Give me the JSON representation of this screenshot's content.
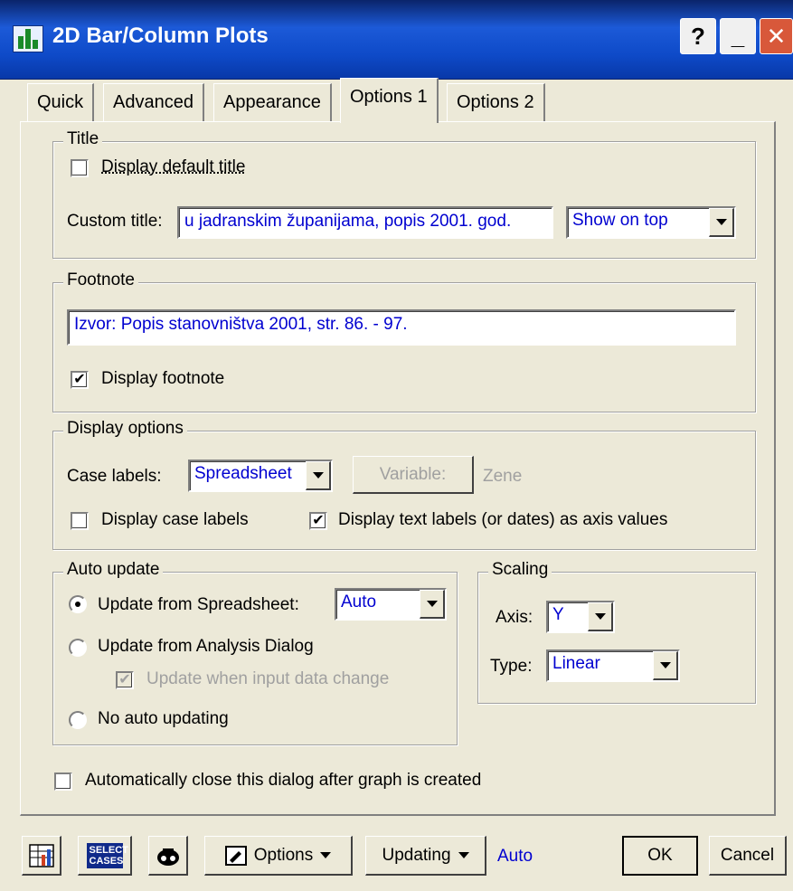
{
  "window": {
    "title": "2D Bar/Column Plots"
  },
  "title_buttons": {
    "help": "?",
    "minimize": "_",
    "close": "✕"
  },
  "tabs": [
    "Quick",
    "Advanced",
    "Appearance",
    "Options 1",
    "Options 2"
  ],
  "active_tab": "Options 1",
  "title_group": {
    "legend": "Title",
    "display_default_title": {
      "label": "Display default title",
      "checked": false
    },
    "custom_title_label": "Custom title:",
    "custom_title_value": "u jadranskim županijama, popis 2001. god.",
    "position": "Show on top"
  },
  "footnote_group": {
    "legend": "Footnote",
    "value": "Izvor: Popis stanovništva 2001,  str. 86. - 97.",
    "display_footnote": {
      "label": "Display footnote",
      "checked": true
    }
  },
  "display_options": {
    "legend": "Display options",
    "case_labels_label": "Case labels:",
    "case_labels_value": "Spreadsheet",
    "variable_button": "Variable:",
    "variable_value": "Zene",
    "display_case_labels": {
      "label": "Display case labels",
      "checked": false
    },
    "display_text_labels": {
      "label": "Display text labels (or dates) as axis values",
      "checked": true
    }
  },
  "auto_update": {
    "legend": "Auto update",
    "from_spreadsheet": {
      "label": "Update from Spreadsheet:",
      "selected": true
    },
    "spreadsheet_mode": "Auto",
    "from_analysis": {
      "label": "Update from Analysis Dialog",
      "selected": false
    },
    "when_input_changes": {
      "label": "Update when input data change",
      "checked": true,
      "disabled": true
    },
    "no_auto": {
      "label": "No auto updating",
      "selected": false
    }
  },
  "scaling": {
    "legend": "Scaling",
    "axis_label": "Axis:",
    "axis_value": "Y",
    "type_label": "Type:",
    "type_value": "Linear"
  },
  "auto_close": {
    "label": "Automatically close this dialog after graph is created",
    "checked": false
  },
  "bottom_bar": {
    "select_cases_icon_text": "SELECT CASES",
    "options_button": "Options",
    "updating_button": "Updating",
    "updating_status": "Auto",
    "ok_button": "OK",
    "cancel_button": "Cancel"
  },
  "colors": {
    "titlebar": "#0a4ac8",
    "dialog_bg": "#ece9d8",
    "value_text": "#0000d0",
    "close": "#d8583a"
  }
}
